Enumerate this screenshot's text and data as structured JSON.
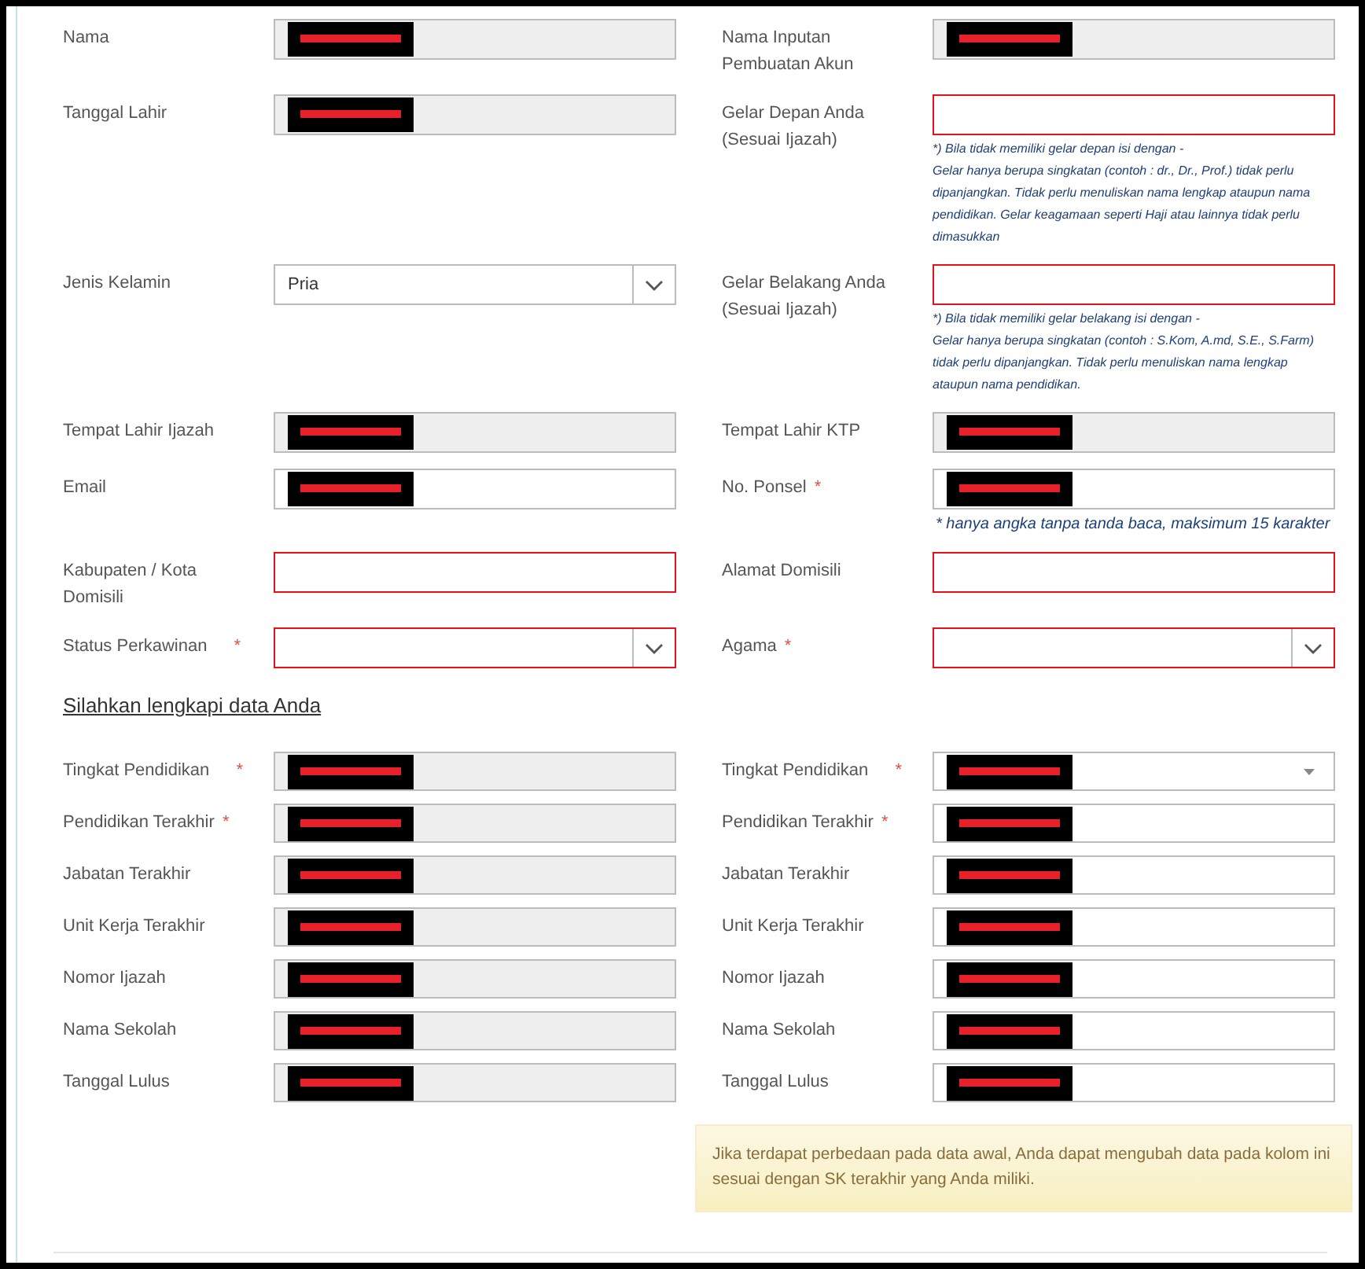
{
  "rows": [
    {
      "left": {
        "label": "Nama",
        "kind": "readonly",
        "redacted": true,
        "invalid": false
      },
      "right": {
        "label": "Nama Inputan Pembuatan Akun",
        "kind": "readonly",
        "redacted": true,
        "invalid": false
      }
    },
    {
      "left": {
        "label": "Tanggal Lahir",
        "kind": "readonly",
        "redacted": true,
        "invalid": false
      },
      "right": {
        "label": "Gelar Depan Anda (Sesuai Ijazah)",
        "kind": "text",
        "invalid": true,
        "hint": [
          "*) Bila tidak memiliki gelar depan isi dengan -",
          "Gelar hanya berupa singkatan (contoh : dr., Dr., Prof.) tidak perlu dipanjangkan. Tidak perlu menuliskan nama lengkap ataupun nama pendidikan. Gelar keagamaan seperti Haji atau lainnya tidak perlu dimasukkan"
        ]
      }
    },
    {
      "left": {
        "label": "Jenis Kelamin",
        "kind": "select",
        "value": "Pria",
        "invalid": false
      },
      "right": {
        "label": "Gelar Belakang Anda (Sesuai Ijazah)",
        "kind": "text",
        "invalid": true,
        "hint": [
          "*) Bila tidak memiliki gelar belakang isi dengan -",
          "Gelar hanya berupa singkatan (contoh : S.Kom, A.md, S.E., S.Farm) tidak perlu dipanjangkan. Tidak perlu menuliskan nama lengkap ataupun nama pendidikan."
        ]
      }
    },
    {
      "left": {
        "label": "Tempat Lahir Ijazah",
        "kind": "readonly",
        "redacted": true,
        "invalid": false
      },
      "right": {
        "label": "Tempat Lahir KTP",
        "kind": "readonly",
        "redacted": true,
        "invalid": false
      }
    },
    {
      "left": {
        "label": "Email",
        "kind": "text",
        "redacted": true,
        "invalid": false
      },
      "right": {
        "label": "No. Ponsel",
        "mark": "*",
        "kind": "text",
        "redacted": true,
        "invalid": false,
        "hint": [
          "* hanya angka tanpa tanda baca, maksimum 15 karakter"
        ]
      }
    },
    {
      "left": {
        "label": "Kabupaten / Kota Domisili",
        "kind": "text",
        "invalid": true
      },
      "right": {
        "label": "Alamat Domisili",
        "kind": "text",
        "invalid": true
      }
    },
    {
      "left": {
        "label": "Status Perkawinan",
        "mark": "*",
        "mark_apart": true,
        "kind": "select",
        "invalid": true
      },
      "right": {
        "label": "Agama",
        "mark": "*",
        "kind": "select",
        "invalid": true
      }
    }
  ],
  "section_title": "Silahkan lengkapi data Anda",
  "left_fields": [
    {
      "label": "Tingkat Pendidikan",
      "mark": "*",
      "mark_apart": true,
      "kind": "readonly",
      "redacted": true,
      "invalid": false
    },
    {
      "label": "Pendidikan Terakhir",
      "mark": "*",
      "kind": "readonly",
      "redacted": true,
      "invalid": false
    },
    {
      "label": "Jabatan Terakhir",
      "kind": "readonly",
      "redacted": true,
      "invalid": false
    },
    {
      "label": "Unit Kerja Terakhir",
      "kind": "readonly",
      "redacted": true,
      "invalid": false
    },
    {
      "label": "Nomor Ijazah",
      "kind": "readonly",
      "redacted": true,
      "invalid": false
    },
    {
      "label": "Nama Sekolah",
      "kind": "readonly",
      "redacted": true,
      "invalid": false
    },
    {
      "label": "Tanggal Lulus",
      "kind": "readonly",
      "redacted": true,
      "invalid": false
    }
  ],
  "right_fields": [
    {
      "label": "Tingkat Pendidikan",
      "mark": "*",
      "mark_apart": true,
      "kind": "dropdown",
      "redacted": true,
      "invalid": false
    },
    {
      "label": "Pendidikan Terakhir",
      "mark": "*",
      "kind": "text",
      "redacted": true,
      "invalid": false
    },
    {
      "label": "Jabatan Terakhir",
      "kind": "text",
      "redacted": true,
      "invalid": false
    },
    {
      "label": "Unit Kerja Terakhir",
      "kind": "text",
      "redacted": true,
      "invalid": false
    },
    {
      "label": "Nomor Ijazah",
      "kind": "text",
      "redacted": true,
      "invalid": false
    },
    {
      "label": "Nama Sekolah",
      "kind": "text",
      "redacted": true,
      "invalid": false
    },
    {
      "label": "Tanggal Lulus",
      "kind": "text",
      "redacted": true,
      "invalid": false
    }
  ],
  "notice": "Jika terdapat perbedaan pada data awal, Anda dapat mengubah data pada kolom ini sesuai dengan SK terakhir yang Anda miliki."
}
